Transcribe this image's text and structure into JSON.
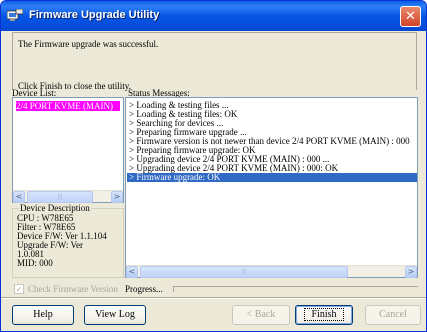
{
  "window": {
    "title": "Firmware Upgrade Utility",
    "close_glyph": "✕",
    "icon": "firmware-app-icon"
  },
  "message": {
    "line1": "The Firmware upgrade was successful.",
    "line2": "Click Finish to close the utility."
  },
  "labels": {
    "device_list": "Device List:",
    "status_messages": "Status Messages:"
  },
  "device_list": {
    "items": [
      "2/4 PORT KVME (MAIN)"
    ]
  },
  "scroll_glyphs": {
    "left": "<",
    "right": ">",
    "grip": "|||"
  },
  "device_description": {
    "title": "Device Description",
    "lines": [
      "CPU : W78E65",
      "Filter : W78E65",
      "Device F/W: Ver 1.1.104",
      "Upgrade F/W: Ver",
      "1.0.081",
      "MID: 000"
    ]
  },
  "status_messages": [
    "> Loading & testing files ...",
    "> Loading & testing files: OK",
    "> Searching for devices ...",
    "> Preparing firmware upgrade ...",
    "> Firmware version is not newer than device 2/4 PORT KVME (MAIN) : 000",
    "> Preparing firmware upgrade: OK",
    "> Upgrading device 2/4 PORT KVME (MAIN) : 000 ...",
    "> Upgrading device 2/4 PORT KVME (MAIN) : 000: OK",
    "> Firmware upgrade: OK"
  ],
  "check_firmware": {
    "label": "Check Firmware Version",
    "checked": true,
    "mark": "✓"
  },
  "progress": {
    "label": "Progress...",
    "value": 0
  },
  "buttons": {
    "help": "Help",
    "view_log": "View Log",
    "back": "< Back",
    "finish": "Finish",
    "cancel": "Cancel"
  },
  "colors": {
    "title_blue": "#0656e6",
    "selected_device": "#ff00ff",
    "selected_status": "#316ac5",
    "window_bg": "#ece9d8"
  }
}
